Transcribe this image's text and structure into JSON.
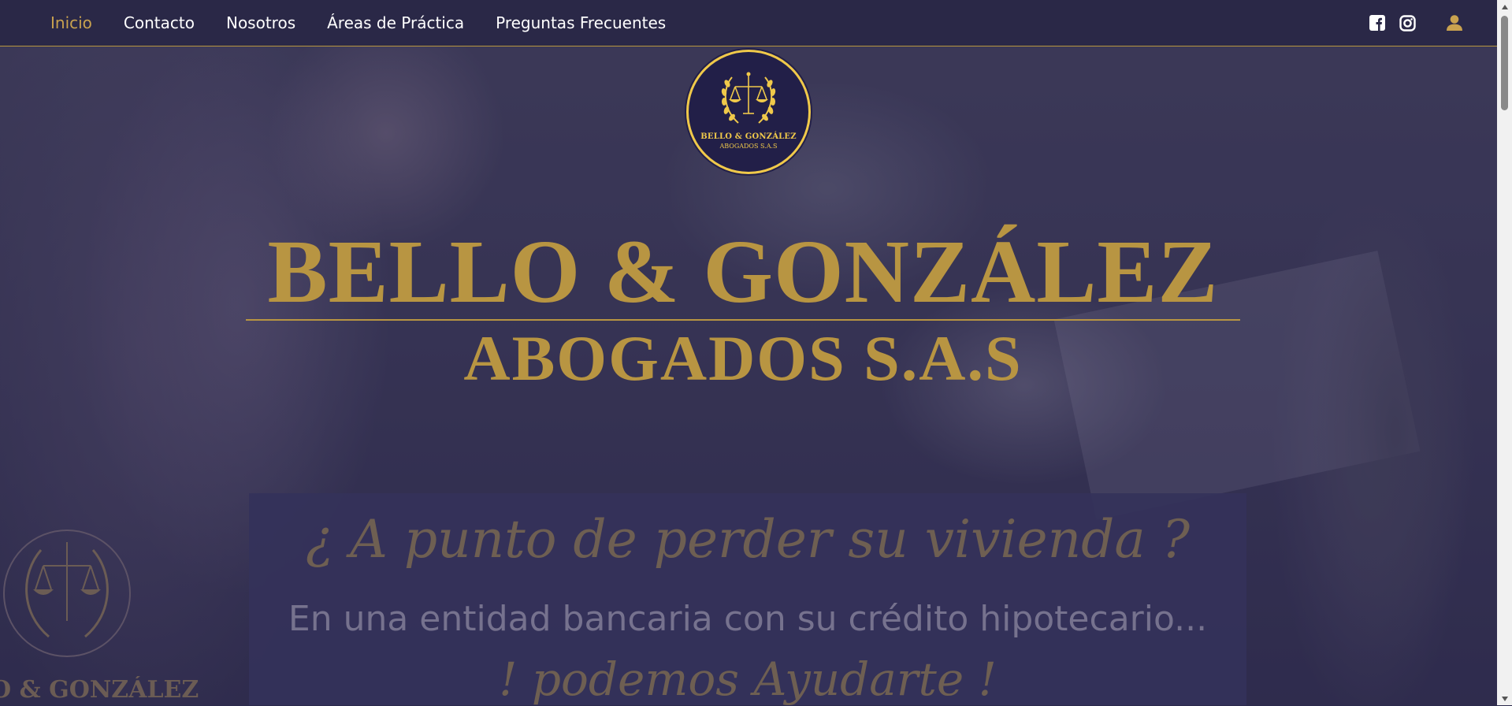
{
  "nav": {
    "links": [
      "Inicio",
      "Contacto",
      "Nosotros",
      "Áreas de Práctica",
      "Preguntas Frecuentes"
    ],
    "active": "Inicio",
    "icons": [
      "facebook-icon",
      "instagram-icon",
      "user-icon"
    ]
  },
  "logo": {
    "name": "BELLO & GONZÁLEZ",
    "sub": "ABOGADOS S.A.S"
  },
  "hero": {
    "title": "BELLO & GONZÁLEZ",
    "subtitle": "ABOGADOS S.A.S"
  },
  "banner": {
    "headline": "¿ A punto de perder su vivienda ?",
    "text": "En una entidad bancaria con su crédito hipotecario...",
    "cta": "! podemos Ayudarte !",
    "side_text": "O & GONZÁLEZ"
  },
  "colors": {
    "navbar": "#2a2847",
    "gold": "#b89542",
    "active_link": "#c9a24f",
    "badge_ring": "#f0c94a"
  }
}
